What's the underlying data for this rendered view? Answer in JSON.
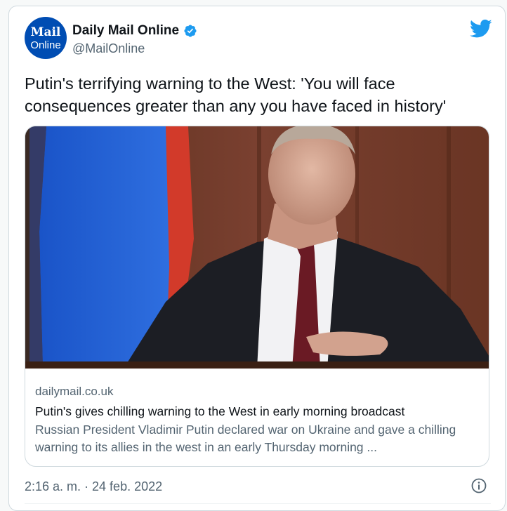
{
  "account": {
    "avatar_line1": "Mail",
    "avatar_line2": "Online",
    "display_name": "Daily Mail Online",
    "handle": "@MailOnline"
  },
  "tweet": {
    "text": "Putin's terrifying warning to the West: 'You will face consequences greater than any you have faced in history'",
    "timestamp": "2:16 a. m. · 24 feb. 2022"
  },
  "link_card": {
    "domain": "dailymail.co.uk",
    "title": "Putin's gives chilling warning to the West in early morning broadcast",
    "description": "Russian President Vladimir Putin declared war on Ukraine and gave a chilling warning to its allies in the west in an early Thursday morning ..."
  },
  "icons": {
    "verified": "verified-badge-icon",
    "twitter": "twitter-bird-icon",
    "info": "info-icon"
  },
  "colors": {
    "twitter_blue": "#1d9bf0",
    "avatar_bg": "#004db3",
    "secondary_text": "#536471",
    "border": "#cfd9de"
  }
}
